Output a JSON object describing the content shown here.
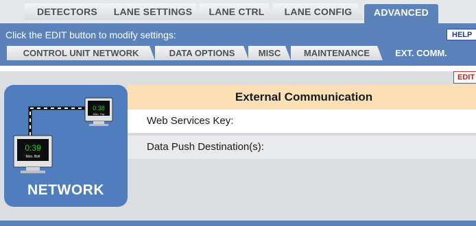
{
  "top_tabs": [
    {
      "label": "DETECTORS",
      "active": false
    },
    {
      "label": "LANE SETTINGS",
      "active": false
    },
    {
      "label": "LANE CTRL",
      "active": false
    },
    {
      "label": "LANE CONFIG",
      "active": false
    },
    {
      "label": "ADVANCED",
      "active": true
    }
  ],
  "header": {
    "instruction": "Click the EDIT button to modify settings:",
    "help_label": "HELP"
  },
  "sub_tabs": [
    {
      "label": "CONTROL UNIT NETWORK",
      "active": false
    },
    {
      "label": "DATA OPTIONS",
      "active": false
    },
    {
      "label": "MISC",
      "active": false
    },
    {
      "label": "MAINTENANCE",
      "active": false
    },
    {
      "label": "EXT. COMM.",
      "active": true
    }
  ],
  "edit_label": "EDIT",
  "network_panel": {
    "label": "NETWORK",
    "monitor_small_time": "0:38",
    "monitor_small_caption": "Mon. Trip",
    "monitor_large_time": "0:39",
    "monitor_large_caption": "Mon. Bolt"
  },
  "external_comm": {
    "title": "External Communication",
    "rows": [
      {
        "label": "Web Services Key:"
      },
      {
        "label": "Data Push Destination(s):"
      }
    ]
  },
  "colors": {
    "accent_blue": "#5c82bb",
    "header_peach": "#fbe0b5",
    "edit_red": "#d01818"
  }
}
